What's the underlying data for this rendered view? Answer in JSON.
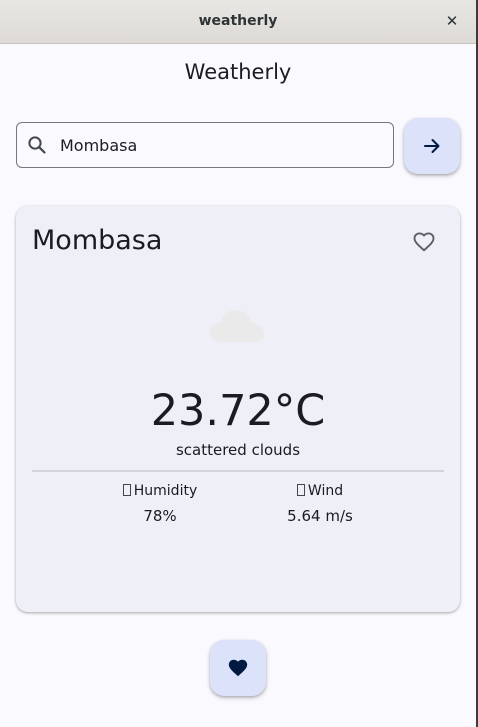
{
  "window": {
    "title": "weatherly",
    "close_glyph": "✕"
  },
  "app": {
    "title": "Weatherly"
  },
  "search": {
    "icon": "search-icon",
    "value": "Mombasa",
    "submit_icon": "arrow-forward-icon"
  },
  "weather": {
    "city": "Mombasa",
    "favorite_icon": "heart-outline-icon",
    "condition_icon": "cloud-icon",
    "temperature": "23.72°C",
    "description": "scattered clouds",
    "humidity": {
      "label": "Humidity",
      "value": "78%"
    },
    "wind": {
      "label": "Wind",
      "value": "5.64 m/s"
    }
  },
  "favorites_button": {
    "icon": "heart-filled-icon"
  },
  "colors": {
    "background": "#f9f9fe",
    "card": "#eff0f7",
    "fab": "#dbe2f9",
    "text": "#1b1b21",
    "icon_dark": "#001a41",
    "titlebar": "#dedbd7"
  }
}
